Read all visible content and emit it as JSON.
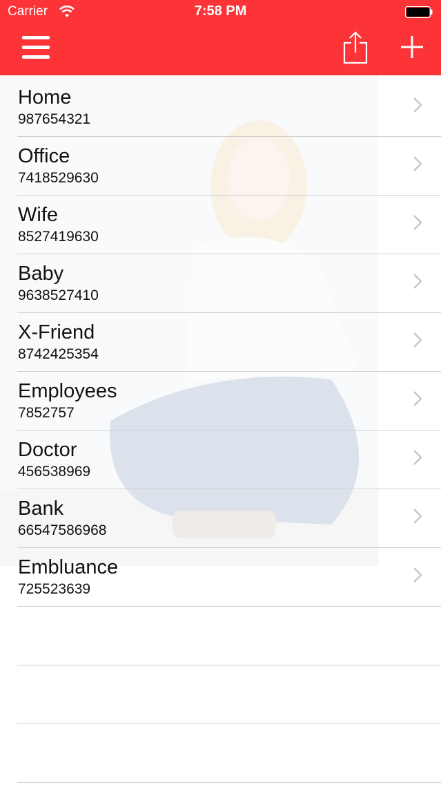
{
  "status_bar": {
    "carrier": "Carrier",
    "time": "7:58 PM"
  },
  "nav": {
    "background": "#fc3438",
    "menu_icon": "hamburger-menu-icon",
    "share_icon": "share-icon",
    "add_icon": "plus-icon"
  },
  "contacts": [
    {
      "name": "Home",
      "phone": "987654321"
    },
    {
      "name": "Office",
      "phone": "7418529630"
    },
    {
      "name": "Wife",
      "phone": "8527419630"
    },
    {
      "name": "Baby",
      "phone": "9638527410"
    },
    {
      "name": "X-Friend",
      "phone": "8742425354"
    },
    {
      "name": "Employees",
      "phone": "7852757"
    },
    {
      "name": "Doctor",
      "phone": "456538969"
    },
    {
      "name": "Bank",
      "phone": "66547586968"
    },
    {
      "name": "Embluance",
      "phone": "725523639"
    }
  ]
}
